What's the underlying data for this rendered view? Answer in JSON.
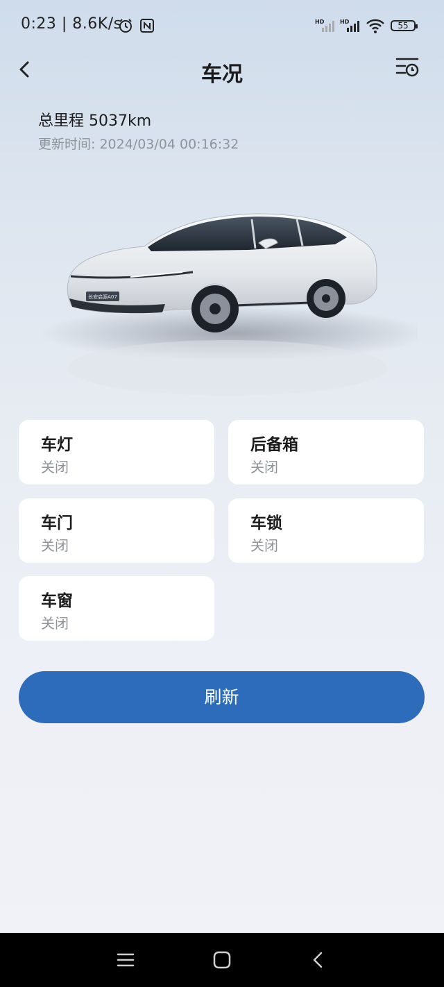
{
  "status_bar": {
    "time": "0:23 | 8.6K/s",
    "battery": "55",
    "icons": [
      "alarm-icon",
      "nfc-icon",
      "signal-hd-icon",
      "signal-hd-icon",
      "wifi-icon",
      "battery-icon"
    ]
  },
  "header": {
    "title": "车况",
    "back_icon": "chevron-left-icon",
    "history_icon": "history-list-icon"
  },
  "info": {
    "mileage": "总里程 5037km",
    "updated": "更新时间: 2024/03/04 00:16:32"
  },
  "vehicle": {
    "badge": "长安启源A07",
    "color": "#e9ebee"
  },
  "status_cards": [
    {
      "label": "车灯",
      "value": "关闭"
    },
    {
      "label": "后备箱",
      "value": "关闭"
    },
    {
      "label": "车门",
      "value": "关闭"
    },
    {
      "label": "车锁",
      "value": "关闭"
    },
    {
      "label": "车窗",
      "value": "关闭"
    }
  ],
  "actions": {
    "refresh_label": "刷新",
    "accent": "#2c6cbb"
  },
  "nav_bar": {
    "icons": [
      "menu-icon",
      "home-square-icon",
      "back-triangle-icon"
    ]
  }
}
